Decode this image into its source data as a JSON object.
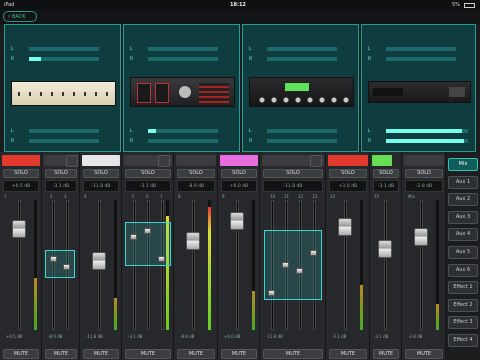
{
  "statusbar": {
    "carrier": "iPad",
    "time": "18:12",
    "battery": "5%"
  },
  "nav": {
    "back_label": "BACK"
  },
  "racks": [
    {
      "meters_top": [
        "L",
        "R"
      ],
      "meters_bottom": [
        "L",
        "R"
      ]
    },
    {
      "meters_top": [
        "L",
        "R"
      ],
      "meters_bottom": [
        "L",
        "R"
      ]
    },
    {
      "meters_top": [
        "L",
        "R"
      ],
      "meters_bottom": [
        "L",
        "R"
      ]
    },
    {
      "meters_top": [
        "L",
        "R"
      ],
      "meters_bottom": [
        "L",
        "R"
      ]
    }
  ],
  "strips": [
    {
      "color": "#e23b2e",
      "solo": "SOLO",
      "gain": "+0.5 dB",
      "bottom": "+0.5 dB",
      "mute": "MUTE",
      "numbers": [
        "1"
      ]
    },
    {
      "color": "#3a3c3f",
      "solo": "SOLO",
      "gain": "-3.1 dB",
      "bottom": "-8.9 dB",
      "mute": "MUTE",
      "numbers": [
        "2",
        "3"
      ]
    },
    {
      "color": "#e6e6e6",
      "solo": "SOLO",
      "gain": "-11.8 dB",
      "bottom": "-11.8 dB",
      "mute": "MUTE",
      "numbers": [
        "4"
      ]
    },
    {
      "color": "#3a3c3f",
      "solo": "SOLO",
      "gain": "-3.1 dB",
      "bottom": "-3.1 dB",
      "mute": "MUTE",
      "numbers": [
        "5",
        "6",
        "7"
      ]
    },
    {
      "color": "#3a3c3f",
      "solo": "SOLO",
      "gain": "-8.9 dB",
      "bottom": "-8.9 dB",
      "mute": "MUTE",
      "numbers": [
        "8"
      ]
    },
    {
      "color": "#e86de0",
      "solo": "SOLO",
      "gain": "+6.0 dB",
      "bottom": "+6.0 dB",
      "mute": "MUTE",
      "numbers": [
        "9"
      ]
    },
    {
      "color": "#3a3c3f",
      "solo": "SOLO",
      "gain": "-11.8 dB",
      "bottom": "-11.8 dB",
      "mute": "MUTE",
      "numbers": [
        "10",
        "11",
        "12",
        "13"
      ]
    },
    {
      "color": "#e23b2e",
      "solo": "SOLO",
      "gain": "+1.0 dB",
      "bottom": "-3.1 dB",
      "mute": "MUTE",
      "numbers": [
        "14"
      ]
    },
    {
      "color": "#66dd55",
      "solo": "SOLO",
      "gain": "-3.1 dB",
      "bottom": "-3.1 dB",
      "mute": "MUTE",
      "numbers": [
        "15"
      ]
    },
    {
      "color": "#3a3c3f",
      "solo": "SOLO",
      "gain": "-2.8 dB",
      "bottom": "-2.8 dB",
      "mute": "MUTE",
      "numbers": [
        "Mix"
      ]
    }
  ],
  "buses": [
    "Mix",
    "Aux 1",
    "Aux 2",
    "Aux 3",
    "Aux 4",
    "Aux 5",
    "Aux 6",
    "Effect 1",
    "Effect 2",
    "Effect 3",
    "Effect 4"
  ],
  "active_bus": "Mix",
  "colors": {
    "accent": "#36d7d0",
    "panel": "#0f3d3f"
  }
}
